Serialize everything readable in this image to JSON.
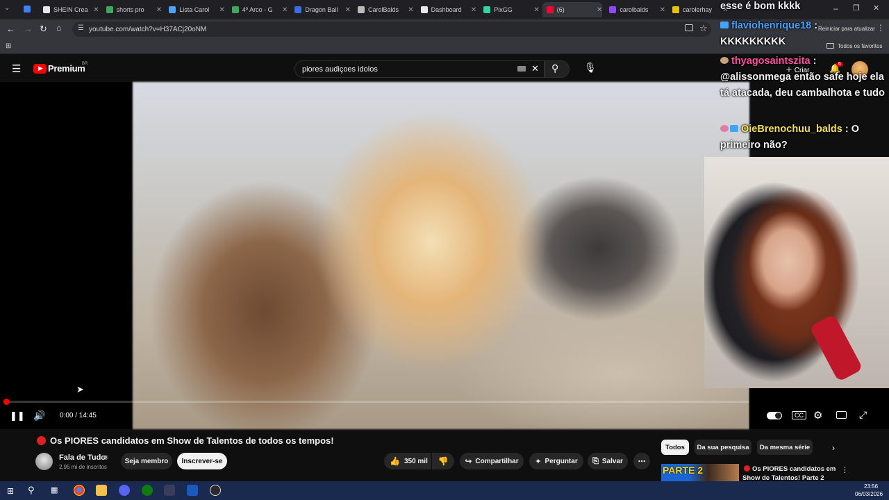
{
  "browser": {
    "tabs": [
      {
        "label": "SHEIN Crea",
        "color": "#e8e8e8",
        "letter": "S"
      },
      {
        "label": "shorts pro",
        "color": "#3ea85b"
      },
      {
        "label": "Lista Carol",
        "color": "#4aa3ff"
      },
      {
        "label": "4º Arco - G",
        "color": "#3ea85b"
      },
      {
        "label": "Dragon Ball",
        "color": "#3b6fe0"
      },
      {
        "label": "CarolBalds",
        "color": "#bbbbbb"
      },
      {
        "label": "Dashboard",
        "color": "#e8e8e8"
      },
      {
        "label": "PixGG",
        "color": "#2fd6a0"
      },
      {
        "label": "(6)",
        "color": "#ff0033",
        "active": true
      },
      {
        "label": "carolbalds",
        "color": "#9147ff"
      },
      {
        "label": "carolerhay",
        "color": "#e6c300"
      }
    ],
    "url": "youtube.com/watch?v=H37ACj20oNM",
    "bookmarks_folder": "Todos os favoritos",
    "restart_label": "Reiniciar para atualizar"
  },
  "youtube": {
    "logo_text": "Premium",
    "logo_badge": "BR",
    "search_value": "piores audiçoes idolos",
    "create_label": "Criar",
    "notifications_count": "6"
  },
  "player": {
    "time": "0:00 / 14:45",
    "progress_fraction": 0.0
  },
  "chat": [
    {
      "user": "",
      "message": "esse é bom kkkk",
      "user_color": "#ffffff"
    },
    {
      "user": "flaviohenrique18",
      "message": "KKKKKKKKK",
      "user_color": "#3ea6ff"
    },
    {
      "user": "thyagosaintszita",
      "message": "@alissonmega então safe hoje ela tá atacada, deu cambalhota e tudo",
      "user_color": "#ff4fa3"
    },
    {
      "user": "OieBrenochuu_balds",
      "message": "O primeiro não?",
      "user_color": "#f5e04a"
    }
  ],
  "video_info": {
    "title": "Os PIORES candidatos em Show de Talentos de todos os tempos!",
    "channel_name": "Fala de Tudo",
    "subscribers": "2,95 mi de inscritos",
    "join_label": "Seja membro",
    "subscribe_label": "Inscrever-se",
    "likes": "350 mil",
    "share_label": "Compartilhar",
    "ask_label": "Perguntar",
    "save_label": "Salvar"
  },
  "recommendations": {
    "chips": [
      "Todos",
      "Da sua pesquisa",
      "Da mesma série"
    ],
    "first_item": {
      "thumb_text": "PARTE 2",
      "title": "Os PIORES candidatos em Show de Talentos! Parte 2"
    }
  },
  "taskbar": {
    "time": "23:56",
    "date": "06/03/2026"
  }
}
